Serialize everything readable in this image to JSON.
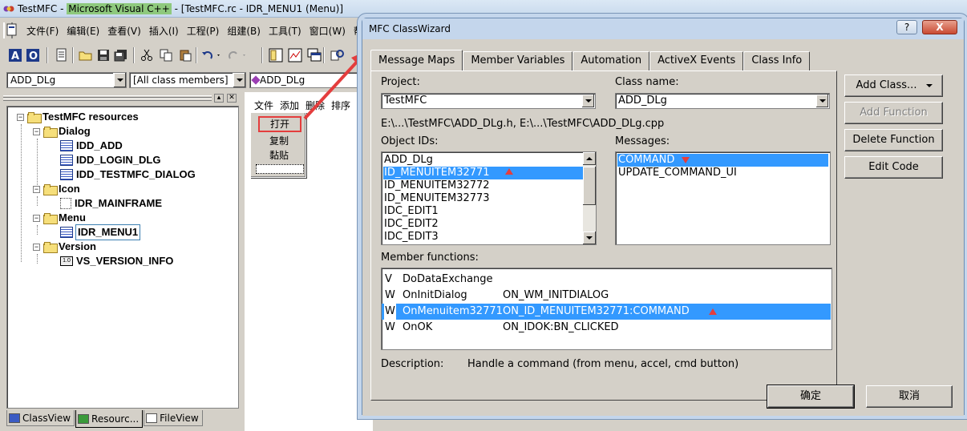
{
  "ide": {
    "title_pre": "TestMFC - ",
    "title_app": "Microsoft Visual C++",
    "title_post": " - [TestMFC.rc - IDR_MENU1 (Menu)]",
    "menu": [
      "文件(F)",
      "编辑(E)",
      "查看(V)",
      "插入(I)",
      "工程(P)",
      "组建(B)",
      "工具(T)",
      "窗口(W)",
      "帮助("
    ],
    "combo_class": "ADD_DLg",
    "combo_filter": "[All class members]",
    "combo_member": "ADD_DLg"
  },
  "workspace": {
    "root": "TestMFC resources",
    "dialog_folder": "Dialog",
    "dialogs": [
      "IDD_ADD",
      "IDD_LOGIN_DLG",
      "IDD_TESTMFC_DIALOG"
    ],
    "icon_folder": "Icon",
    "icons": [
      "IDR_MAINFRAME"
    ],
    "menu_folder": "Menu",
    "menus": [
      "IDR_MENU1"
    ],
    "version_folder": "Version",
    "versions": [
      "VS_VERSION_INFO"
    ],
    "tabs": [
      "ClassView",
      "Resourc...",
      "FileView"
    ]
  },
  "editor": {
    "menubar": [
      "文件",
      "添加",
      "删除",
      "排序"
    ],
    "dropdown": [
      "打开",
      "复制",
      "黏贴"
    ]
  },
  "wizard": {
    "title": "MFC ClassWizard",
    "help_btn": "?",
    "close_btn": "X",
    "tabs": [
      "Message Maps",
      "Member Variables",
      "Automation",
      "ActiveX Events",
      "Class Info"
    ],
    "project_label": "Project:",
    "project_value": "TestMFC",
    "classname_label": "Class name:",
    "classname_value": "ADD_DLg",
    "path": "E:\\...\\TestMFC\\ADD_DLg.h, E:\\...\\TestMFC\\ADD_DLg.cpp",
    "objectids_label": "Object IDs:",
    "object_ids": [
      "ADD_DLg",
      "ID_MENUITEM32771",
      "ID_MENUITEM32772",
      "ID_MENUITEM32773",
      "IDC_EDIT1",
      "IDC_EDIT2",
      "IDC_EDIT3"
    ],
    "selected_object_id": "ID_MENUITEM32771",
    "messages_label": "Messages:",
    "messages": [
      "COMMAND",
      "UPDATE_COMMAND_UI"
    ],
    "selected_message": "COMMAND",
    "member_functions_label": "Member functions:",
    "member_functions": [
      {
        "kind": "V",
        "name": "DoDataExchange",
        "msg": ""
      },
      {
        "kind": "W",
        "name": "OnInitDialog",
        "msg": "ON_WM_INITDIALOG"
      },
      {
        "kind": "W",
        "name": "OnMenuitem32771",
        "msg": "ON_ID_MENUITEM32771:COMMAND"
      },
      {
        "kind": "W",
        "name": "OnOK",
        "msg": "ON_IDOK:BN_CLICKED"
      }
    ],
    "selected_member": "OnMenuitem32771",
    "description_label": "Description:",
    "description": "Handle a command (from menu, accel, cmd button)",
    "buttons": {
      "add_class": "Add Class...",
      "add_function": "Add Function",
      "delete_function": "Delete Function",
      "edit_code": "Edit Code",
      "ok": "确定",
      "cancel": "取消"
    }
  },
  "colors": {
    "selection": "#3399ff",
    "annotation": "#e43d3d",
    "face": "#d4d0c8"
  }
}
